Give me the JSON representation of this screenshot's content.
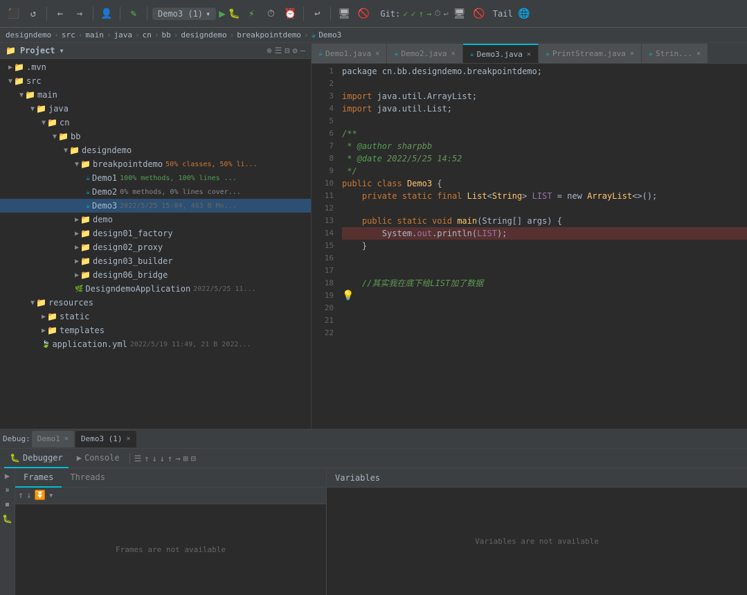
{
  "toolbar": {
    "run_config": "Demo3 (1)",
    "git_label": "Git:",
    "tail_label": "Tail",
    "buttons": [
      "⬛",
      "↺",
      "←",
      "→",
      "👤",
      "✏️",
      "▶",
      "🐛",
      "📦",
      "⏰",
      "↩",
      "🖥",
      "🚫",
      "🌐"
    ]
  },
  "breadcrumb": {
    "items": [
      "designdemo",
      "src",
      "main",
      "java",
      "cn",
      "bb",
      "designdemo",
      "breakpointdemo",
      "Demo3"
    ]
  },
  "sidebar": {
    "title": "Project",
    "tree": [
      {
        "label": ".mvn",
        "indent": 1,
        "type": "folder",
        "expanded": false
      },
      {
        "label": "src",
        "indent": 1,
        "type": "folder",
        "expanded": true
      },
      {
        "label": "main",
        "indent": 2,
        "type": "folder",
        "expanded": true
      },
      {
        "label": "java",
        "indent": 3,
        "type": "folder",
        "expanded": true
      },
      {
        "label": "cn",
        "indent": 4,
        "type": "folder",
        "expanded": true
      },
      {
        "label": "bb",
        "indent": 5,
        "type": "folder",
        "expanded": true
      },
      {
        "label": "designdemo",
        "indent": 6,
        "type": "folder",
        "expanded": true
      },
      {
        "label": "breakpointdemo",
        "indent": 7,
        "type": "folder",
        "expanded": true,
        "meta": "50% classes, 50% li..."
      },
      {
        "label": "Demo1",
        "indent": 8,
        "type": "java",
        "meta": "100% methods, 100% lines ..."
      },
      {
        "label": "Demo2",
        "indent": 8,
        "type": "java",
        "meta": "0% methods, 0% lines cover...",
        "selected": false
      },
      {
        "label": "Demo3",
        "indent": 8,
        "type": "java",
        "meta": "2022/5/25 15:04, 493 B Mo...",
        "selected": true
      },
      {
        "label": "demo",
        "indent": 7,
        "type": "folder",
        "expanded": false
      },
      {
        "label": "design01_factory",
        "indent": 7,
        "type": "folder",
        "expanded": false
      },
      {
        "label": "design02_proxy",
        "indent": 7,
        "type": "folder",
        "expanded": false
      },
      {
        "label": "design03_builder",
        "indent": 7,
        "type": "folder",
        "expanded": false
      },
      {
        "label": "design06_bridge",
        "indent": 7,
        "type": "folder",
        "expanded": false
      },
      {
        "label": "DesigndemoApplication",
        "indent": 7,
        "type": "spring",
        "meta": "2022/5/25 11..."
      },
      {
        "label": "resources",
        "indent": 3,
        "type": "folder",
        "expanded": true
      },
      {
        "label": "static",
        "indent": 4,
        "type": "folder",
        "expanded": false
      },
      {
        "label": "templates",
        "indent": 4,
        "type": "folder",
        "expanded": false
      },
      {
        "label": "application.yml",
        "indent": 4,
        "type": "yaml",
        "meta": "2022/5/19 11:49, 21 B 2022..."
      }
    ]
  },
  "tabs": [
    {
      "label": "Demo1.java",
      "active": false,
      "icon": "☕"
    },
    {
      "label": "Demo2.java",
      "active": false,
      "icon": "☕"
    },
    {
      "label": "Demo3.java",
      "active": true,
      "icon": "☕"
    },
    {
      "label": "PrintStream.java",
      "active": false,
      "icon": "☕"
    },
    {
      "label": "Strin...",
      "active": false,
      "icon": "☕"
    }
  ],
  "code": {
    "lines": [
      {
        "num": 1,
        "content": "",
        "tokens": [
          {
            "text": "package cn.bb.designdemo.breakpointdemo;",
            "class": "plain"
          }
        ]
      },
      {
        "num": 2,
        "content": ""
      },
      {
        "num": 3,
        "content": "",
        "tokens": [
          {
            "text": "import ",
            "class": "kw"
          },
          {
            "text": "java.util.ArrayList;",
            "class": "plain"
          }
        ]
      },
      {
        "num": 4,
        "content": "",
        "tokens": [
          {
            "text": "import ",
            "class": "kw"
          },
          {
            "text": "java.util.List;",
            "class": "plain"
          }
        ]
      },
      {
        "num": 5,
        "content": ""
      },
      {
        "num": 6,
        "content": "",
        "tokens": [
          {
            "text": "/**",
            "class": "cm"
          }
        ]
      },
      {
        "num": 7,
        "content": "",
        "tokens": [
          {
            "text": " * ",
            "class": "cm"
          },
          {
            "text": "@author",
            "class": "anno"
          },
          {
            "text": " sharpbb",
            "class": "cm"
          }
        ]
      },
      {
        "num": 8,
        "content": "",
        "tokens": [
          {
            "text": " * ",
            "class": "cm"
          },
          {
            "text": "@date",
            "class": "anno"
          },
          {
            "text": " 2022/5/25 14:52",
            "class": "cm"
          }
        ]
      },
      {
        "num": 9,
        "content": "",
        "tokens": [
          {
            "text": " */",
            "class": "cm"
          }
        ]
      },
      {
        "num": 10,
        "content": "",
        "arrow": true,
        "tokens": [
          {
            "text": "public ",
            "class": "kw"
          },
          {
            "text": "class ",
            "class": "kw"
          },
          {
            "text": "Demo3",
            "class": "cls"
          },
          {
            "text": " {",
            "class": "plain"
          }
        ]
      },
      {
        "num": 11,
        "content": "",
        "tokens": [
          {
            "text": "    private static final ",
            "class": "kw"
          },
          {
            "text": "List",
            "class": "cls"
          },
          {
            "text": "<",
            "class": "plain"
          },
          {
            "text": "String",
            "class": "cls"
          },
          {
            "text": "> ",
            "class": "plain"
          },
          {
            "text": "LIST",
            "class": "var-name"
          },
          {
            "text": " = new ",
            "class": "kw"
          },
          {
            "text": "ArrayList",
            "class": "cls"
          },
          {
            "text": "<>());",
            "class": "plain"
          }
        ]
      },
      {
        "num": 12,
        "content": ""
      },
      {
        "num": 13,
        "content": "",
        "arrow": true,
        "tokens": [
          {
            "text": "    public static void ",
            "class": "kw"
          },
          {
            "text": "main",
            "class": "mth"
          },
          {
            "text": "(String[] args) {",
            "class": "plain"
          }
        ]
      },
      {
        "num": 14,
        "content": "",
        "breakpoint": true,
        "tokens": [
          {
            "text": "        System.",
            "class": "plain"
          },
          {
            "text": "out",
            "class": "var-name"
          },
          {
            "text": ".println(",
            "class": "plain"
          },
          {
            "text": "LIST",
            "class": "var-name"
          },
          {
            "text": ");",
            "class": "plain"
          }
        ]
      },
      {
        "num": 15,
        "content": "",
        "tokens": [
          {
            "text": "    }",
            "class": "plain"
          }
        ]
      },
      {
        "num": 16,
        "content": ""
      },
      {
        "num": 17,
        "content": ""
      },
      {
        "num": 18,
        "content": "",
        "tokens": [
          {
            "text": "    //其实我在底下给LIST加了数据",
            "class": "cm"
          }
        ]
      },
      {
        "num": 19,
        "content": "",
        "bulb": true
      },
      {
        "num": 20,
        "content": ""
      },
      {
        "num": 21,
        "content": ""
      },
      {
        "num": 22,
        "content": ""
      }
    ]
  },
  "debug": {
    "session_label": "Debug:",
    "tabs": [
      {
        "label": "Demo1",
        "close": true
      },
      {
        "label": "Demo3 (1)",
        "close": true,
        "active": true
      }
    ],
    "toolbar_tabs": [
      {
        "label": "Debugger",
        "icon": "🐛",
        "active": true
      },
      {
        "label": "Console",
        "icon": "▶",
        "active": false
      }
    ],
    "frames_tab": {
      "tabs": [
        "Frames",
        "Threads"
      ],
      "active": "Frames",
      "empty_message": "Frames are not available"
    },
    "variables": {
      "header": "Variables",
      "empty_message": "Variables are not available"
    }
  }
}
